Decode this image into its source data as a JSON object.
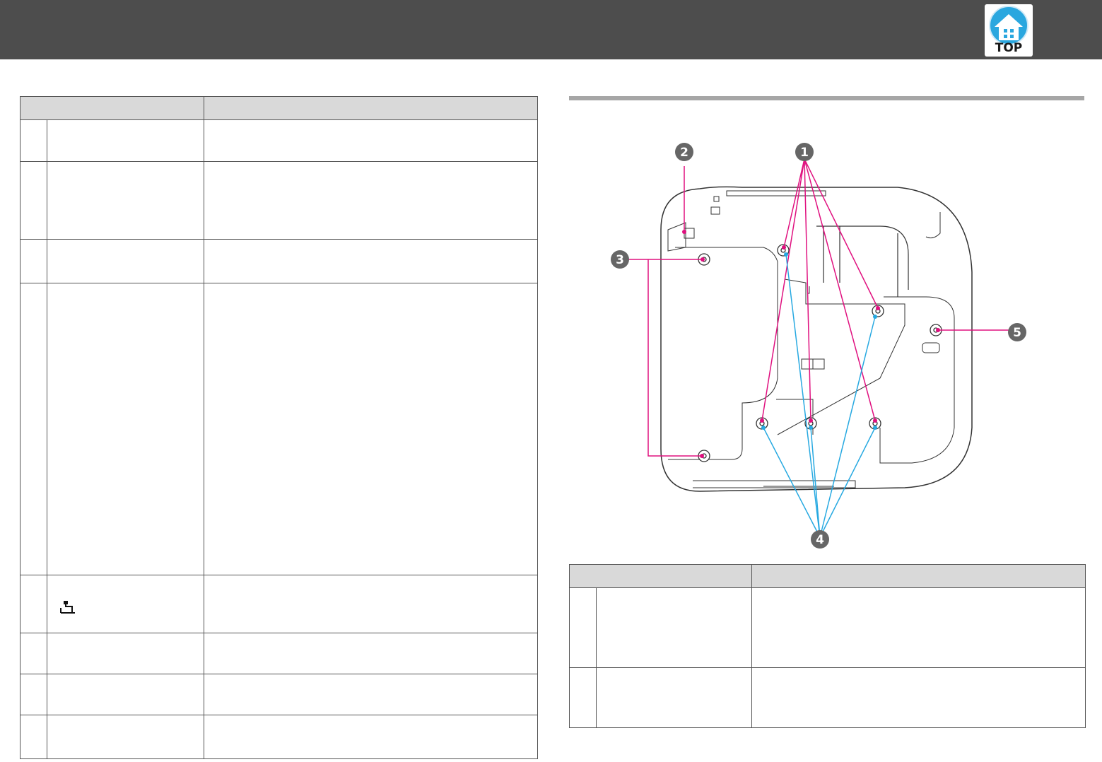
{
  "header": {
    "top_button_label": "TOP",
    "bar_color": "#4d4d4d"
  },
  "diagram": {
    "callouts": [
      "1",
      "2",
      "3",
      "4",
      "5"
    ],
    "magenta": "#e0107f",
    "cyan": "#27a9e1"
  },
  "icons": {
    "top": "house-top-icon",
    "cable": "security-cable-icon"
  }
}
